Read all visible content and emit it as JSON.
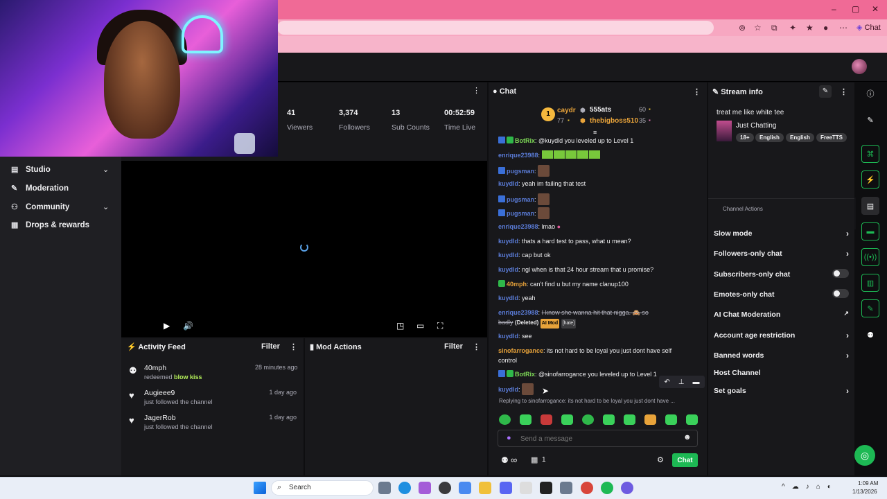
{
  "browser": {
    "chat_label": "Chat"
  },
  "sidebar": {
    "items": [
      {
        "label": "Studio",
        "icon": "studio-icon",
        "chevron": true
      },
      {
        "label": "Moderation",
        "icon": "wrench-icon",
        "chevron": false
      },
      {
        "label": "Community",
        "icon": "community-icon",
        "chevron": true
      },
      {
        "label": "Drops & rewards",
        "icon": "drops-icon",
        "chevron": false
      }
    ]
  },
  "stats": [
    {
      "value": "41",
      "label": "Viewers"
    },
    {
      "value": "3,374",
      "label": "Followers"
    },
    {
      "value": "13",
      "label": "Sub Counts"
    },
    {
      "value": "00:52:59",
      "label": "Time Live"
    }
  ],
  "activity_feed": {
    "title": "Activity Feed",
    "filter_label": "Filter",
    "items": [
      {
        "name": "40mph",
        "sub_prefix": "redeemed ",
        "sub_highlight": "blow kiss",
        "time": "28 minutes ago",
        "icon": "points-icon"
      },
      {
        "name": "Augieee9",
        "sub_prefix": "just followed the channel",
        "sub_highlight": "",
        "time": "1 day ago",
        "icon": "heart-icon"
      },
      {
        "name": "JagerRob",
        "sub_prefix": "just followed the channel",
        "sub_highlight": "",
        "time": "1 day ago",
        "icon": "heart-icon"
      }
    ]
  },
  "mod_actions": {
    "title": "Mod Actions",
    "filter_label": "Filter"
  },
  "chat": {
    "title": "Chat",
    "leaderboard": {
      "first": {
        "rank": "1",
        "name": "caydr",
        "score": "77"
      },
      "second": {
        "name": "555ats",
        "score": "60"
      },
      "third": {
        "name": "thebigboss510",
        "score": "35"
      }
    },
    "messages": [
      {
        "user": "BotRix",
        "text": "@kuydld you leveled up to Level 1"
      },
      {
        "user": "enrique23988",
        "text": ""
      },
      {
        "user": "pugsman",
        "text": ""
      },
      {
        "user": "kuydld",
        "text": "yeah im failing that test"
      },
      {
        "user": "pugsman",
        "text": ""
      },
      {
        "user": "pugsman",
        "text": ""
      },
      {
        "user": "enrique23988",
        "text": "lmao"
      },
      {
        "user": "kuydld",
        "text": "thats a hard test to pass, what u mean?"
      },
      {
        "user": "kuydld",
        "text": "cap but ok"
      },
      {
        "user": "kuydld",
        "text": "ngl when is that 24 hour stream that u promise?"
      },
      {
        "user": "40mph",
        "text": "can't find u but my name clanup100"
      },
      {
        "user": "kuydld",
        "text": "yeah"
      },
      {
        "user": "enrique23988",
        "text": "I know she wanna hit that nigga. 🙈 so badly",
        "deleted": "(Deleted)",
        "ai_mod": "AI Mod",
        "hate": "[hate]"
      },
      {
        "user": "kuydld",
        "text": "see"
      },
      {
        "user": "sinofarrogance",
        "text": "its not hard to be loyal you just dont have self control"
      },
      {
        "user": "BotRix",
        "text": "@sinofarrogance you leveled up to Level 1"
      },
      {
        "user": "kuydld",
        "text": ""
      }
    ],
    "reply_preview": "Replying to sinofarrogance: its not hard to be loyal you just dont have ...",
    "input_placeholder": "Send a message",
    "points": "∞",
    "drops_count": "1",
    "chat_button": "Chat"
  },
  "overlay": {
    "line1_user": "kuydld",
    "line2_user": "kuydld",
    "line2_text": "cap"
  },
  "stream_info": {
    "title": "Stream info",
    "stream_title": "treat me like white tee",
    "category": "Just Chatting",
    "tags": [
      "18+",
      "English",
      "English",
      "FreeTTS"
    ]
  },
  "channel_actions": {
    "title": "Channel Actions",
    "rows": [
      {
        "label": "Slow mode",
        "control": "arrow"
      },
      {
        "label": "Followers-only chat",
        "control": "arrow"
      },
      {
        "label": "Subscribers-only chat",
        "control": "toggle"
      },
      {
        "label": "Emotes-only chat",
        "control": "toggle"
      },
      {
        "label": "AI Chat Moderation",
        "control": "external"
      },
      {
        "label": "Account age restriction",
        "control": "arrow"
      },
      {
        "label": "Banned words",
        "control": "arrow"
      },
      {
        "label": "Host Channel",
        "control": "none"
      },
      {
        "label": "Set goals",
        "control": "arrow"
      }
    ]
  },
  "taskbar": {
    "search_label": "Search",
    "time": "1:09 AM",
    "date": "1/13/2026"
  },
  "colors": {
    "accent_green": "#1db954",
    "twitch_dark": "#18181b",
    "browser_pink": "#f06a96"
  }
}
